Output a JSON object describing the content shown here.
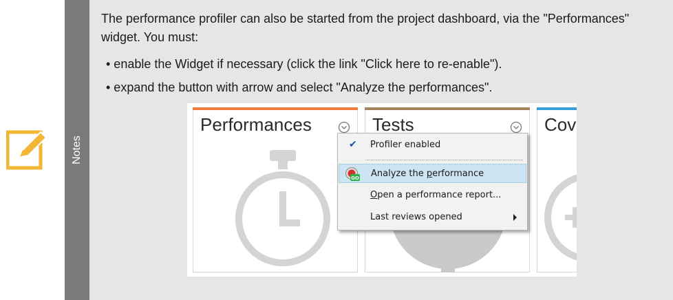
{
  "note": {
    "side_label": "Notes",
    "paragraph": "The performance profiler can also be started from the project dashboard, via the \"Performances\" widget. You must:",
    "bullets": [
      "• enable the Widget if necessary (click the link \"Click here to re-enable\").",
      "• expand the button with arrow and select \"Analyze the performances\"."
    ],
    "colors": {
      "icon": "#f3b536",
      "side": "#7a7a7a",
      "body": "#e6e6e6"
    }
  },
  "screenshot": {
    "widgets": [
      {
        "title": "Performances",
        "bar_color": "#ef7b3a"
      },
      {
        "title": "Tests",
        "bar_color": "#a3845d"
      },
      {
        "title": "Cov",
        "bar_color": "#34a0d8"
      }
    ],
    "menu": {
      "checkmark": "✔",
      "item1": "Profiler enabled",
      "item2_pre": "Analyze the ",
      "item2_u": "p",
      "item2_post": "erformance",
      "item3_pre": "",
      "item3_u": "O",
      "item3_post": "pen a performance report...",
      "item4": "Last reviews opened",
      "go_badge": "GO"
    }
  }
}
